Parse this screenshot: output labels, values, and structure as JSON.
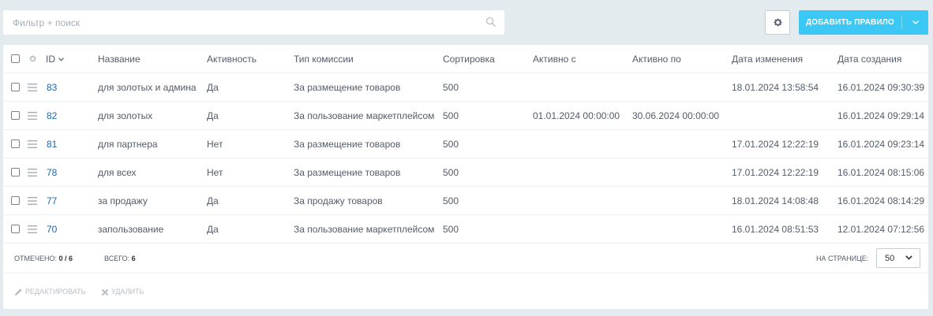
{
  "toolbar": {
    "search_placeholder": "Фильтр + поиск",
    "add_button_label": "ДОБАВИТЬ ПРАВИЛО"
  },
  "grid": {
    "columns": [
      "ID",
      "Название",
      "Активность",
      "Тип комиссии",
      "Сортировка",
      "Активно с",
      "Активно по",
      "Дата изменения",
      "Дата создания"
    ],
    "rows": [
      {
        "id": "83",
        "name": "для золотых и админа",
        "active": "Да",
        "type": "За размещение товаров",
        "sort": "500",
        "from": "",
        "to": "",
        "modified": "18.01.2024 13:58:54",
        "created": "16.01.2024 09:30:39"
      },
      {
        "id": "82",
        "name": "для золотых",
        "active": "Да",
        "type": "За пользование маркетплейсом",
        "sort": "500",
        "from": "01.01.2024 00:00:00",
        "to": "30.06.2024 00:00:00",
        "modified": "",
        "created": "16.01.2024 09:29:14"
      },
      {
        "id": "81",
        "name": "для партнера",
        "active": "Нет",
        "type": "За размещение товаров",
        "sort": "500",
        "from": "",
        "to": "",
        "modified": "17.01.2024 12:22:19",
        "created": "16.01.2024 09:23:14"
      },
      {
        "id": "78",
        "name": "для всех",
        "active": "Нет",
        "type": "За размещение товаров",
        "sort": "500",
        "from": "",
        "to": "",
        "modified": "17.01.2024 12:22:19",
        "created": "16.01.2024 08:15:06"
      },
      {
        "id": "77",
        "name": "за продажу",
        "active": "Да",
        "type": "За продажу товаров",
        "sort": "500",
        "from": "",
        "to": "",
        "modified": "18.01.2024 14:08:48",
        "created": "16.01.2024 08:14:29"
      },
      {
        "id": "70",
        "name": "запользование",
        "active": "Да",
        "type": "За пользование маркетплейсом",
        "sort": "500",
        "from": "",
        "to": "",
        "modified": "16.01.2024 08:51:53",
        "created": "12.01.2024 07:12:56"
      }
    ]
  },
  "footer": {
    "selected_label": "ОТМЕЧЕНО:",
    "selected_value": "0 / 6",
    "total_label": "ВСЕГО:",
    "total_value": "6",
    "per_page_label": "НА СТРАНИЦЕ:",
    "per_page_value": "50"
  },
  "actions": {
    "edit_label": "РЕДАКТИРОВАТЬ",
    "delete_label": "УДАЛИТЬ"
  },
  "colors": {
    "accent": "#3bc8f5",
    "link": "#2067b0",
    "background": "#e3ebef"
  }
}
